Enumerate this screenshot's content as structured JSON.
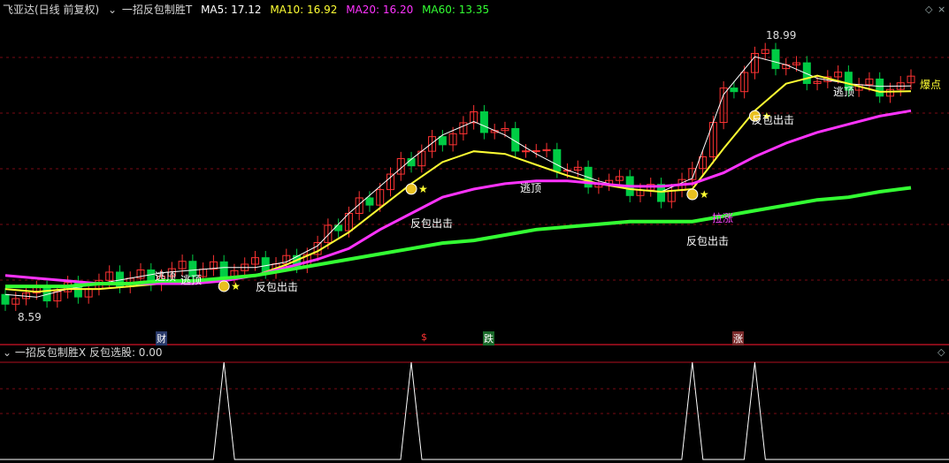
{
  "main_header": {
    "title": "飞亚达(日线 前复权)",
    "indicator": "一招反包制胜T",
    "ma": [
      {
        "label": "MA5: 17.12",
        "color": "#ffffff"
      },
      {
        "label": "MA10: 16.92",
        "color": "#ffff33"
      },
      {
        "label": "MA20: 16.20",
        "color": "#ff33ff"
      },
      {
        "label": "MA60: 13.35",
        "color": "#33ff33"
      }
    ]
  },
  "sub_header": {
    "indicator": "一招反包制胜X",
    "value": "反包选股: 0.00"
  },
  "price_labels": {
    "high": "18.99",
    "low": "8.59"
  },
  "annotations": {
    "escape_top": "逃顶",
    "counter_attack": "反包出击",
    "pull_up": "拉涨",
    "explode": "爆点"
  },
  "event_tags": [
    "财",
    "$",
    "跌",
    "涨"
  ],
  "colors": {
    "up": "#ff3333",
    "down": "#00cc44",
    "ma5": "#ffffff",
    "ma10": "#ffff33",
    "ma20": "#ff33ff",
    "ma60": "#33ff33",
    "signal": "#ffffff"
  },
  "chart_data": [
    {
      "type": "line",
      "title": "",
      "xlabel": "",
      "ylabel": "",
      "series": [
        {
          "name": "MA5",
          "values": [
            9.4,
            9.3,
            9.6,
            9.8,
            10.0,
            10.2,
            10.3,
            10.4,
            10.4,
            10.6,
            11.2,
            12.4,
            13.4,
            14.4,
            15.3,
            15.8,
            15.3,
            14.6,
            14.0,
            13.6,
            13.3,
            13.2,
            13.7,
            16.8,
            18.2,
            17.9,
            17.4,
            17.2,
            17.1,
            17.12
          ]
        },
        {
          "name": "MA10",
          "values": [
            9.6,
            9.5,
            9.6,
            9.6,
            9.7,
            9.8,
            9.9,
            9.9,
            10.1,
            10.5,
            11.0,
            11.7,
            12.6,
            13.5,
            14.3,
            14.7,
            14.6,
            14.2,
            13.8,
            13.5,
            13.3,
            13.2,
            13.3,
            14.8,
            16.2,
            17.2,
            17.5,
            17.2,
            16.9,
            16.92
          ]
        },
        {
          "name": "MA20",
          "values": [
            10.1,
            10.0,
            9.9,
            9.8,
            9.8,
            9.8,
            9.8,
            9.9,
            10.1,
            10.4,
            10.7,
            11.1,
            11.8,
            12.4,
            13.0,
            13.3,
            13.5,
            13.6,
            13.6,
            13.5,
            13.4,
            13.4,
            13.5,
            13.9,
            14.5,
            15.0,
            15.4,
            15.7,
            16.0,
            16.2
          ]
        },
        {
          "name": "MA60",
          "values": [
            9.7,
            9.7,
            9.7,
            9.8,
            9.8,
            9.9,
            9.9,
            10.0,
            10.1,
            10.3,
            10.5,
            10.7,
            10.9,
            11.1,
            11.3,
            11.4,
            11.6,
            11.8,
            11.9,
            12.0,
            12.1,
            12.1,
            12.1,
            12.3,
            12.5,
            12.7,
            12.9,
            13.0,
            13.2,
            13.35
          ]
        }
      ]
    },
    {
      "type": "line",
      "title": "",
      "xlabel": "",
      "ylabel": "",
      "series": [
        {
          "name": "反包选股",
          "values": [
            0,
            0,
            0,
            0,
            0,
            0,
            0,
            1,
            0,
            0,
            0,
            0,
            0,
            1,
            0,
            0,
            0,
            0,
            0,
            0,
            0,
            0,
            1,
            0,
            1,
            0,
            0,
            0,
            0,
            0
          ]
        }
      ]
    }
  ]
}
